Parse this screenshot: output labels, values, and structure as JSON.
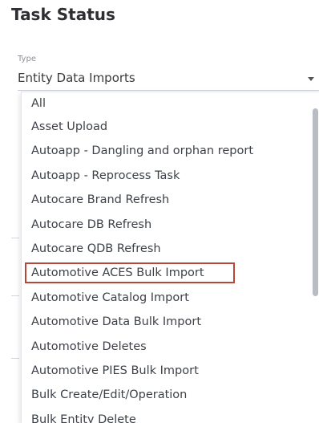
{
  "header": {
    "title": "Task Status"
  },
  "type_field": {
    "caption": "Type",
    "value": "Entity Data Imports",
    "arrow_icon": "chevron-down-icon"
  },
  "menu": {
    "items": [
      {
        "label": "All",
        "highlighted": false
      },
      {
        "label": "Asset Upload",
        "highlighted": false
      },
      {
        "label": "Autoapp - Dangling and orphan report",
        "highlighted": false
      },
      {
        "label": "Autoapp - Reprocess Task",
        "highlighted": false
      },
      {
        "label": "Autocare Brand Refresh",
        "highlighted": false
      },
      {
        "label": "Autocare DB Refresh",
        "highlighted": false
      },
      {
        "label": "Autocare QDB Refresh",
        "highlighted": false
      },
      {
        "label": "Automotive ACES Bulk Import",
        "highlighted": true
      },
      {
        "label": "Automotive Catalog Import",
        "highlighted": false
      },
      {
        "label": "Automotive Data Bulk Import",
        "highlighted": false
      },
      {
        "label": "Automotive Deletes",
        "highlighted": false
      },
      {
        "label": "Automotive PIES Bulk Import",
        "highlighted": false
      },
      {
        "label": "Bulk Create/Edit/Operation",
        "highlighted": false
      },
      {
        "label": "Bulk Entity Delete",
        "highlighted": false
      }
    ],
    "highlight_color": "#b5483b"
  }
}
